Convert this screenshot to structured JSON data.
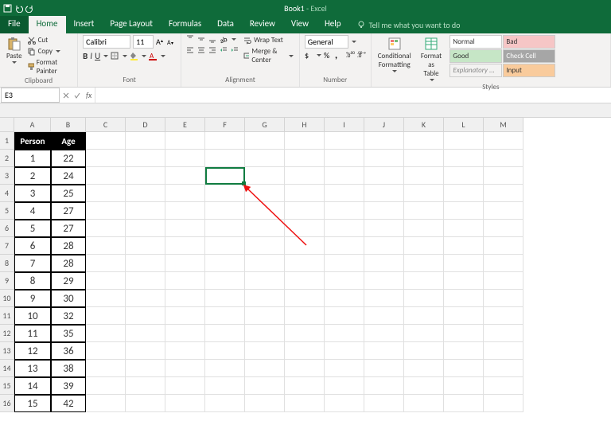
{
  "title": {
    "name": "Book1",
    "app": "Excel"
  },
  "tabs": [
    "File",
    "Home",
    "Insert",
    "Page Layout",
    "Formulas",
    "Data",
    "Review",
    "View",
    "Help"
  ],
  "tell": "Tell me what you want to do",
  "ribbon": {
    "clipboard": {
      "paste": "Paste",
      "cut": "Cut",
      "copy": "Copy",
      "painter": "Format Painter",
      "label": "Clipboard"
    },
    "font": {
      "name": "Calibri",
      "size": "11",
      "label": "Font"
    },
    "alignment": {
      "wrap": "Wrap Text",
      "merge": "Merge & Center",
      "label": "Alignment"
    },
    "number": {
      "format": "General",
      "label": "Number"
    },
    "styles": {
      "cond": "Conditional\nFormatting",
      "fmtas": "Format as\nTable",
      "normal": "Normal",
      "bad": "Bad",
      "good": "Good",
      "check": "Check Cell",
      "expl": "Explanatory ...",
      "input": "Input",
      "label": "Styles"
    }
  },
  "namebox": "E3",
  "cols": [
    "A",
    "B",
    "C",
    "D",
    "E",
    "F",
    "G",
    "H",
    "I",
    "J",
    "K",
    "L",
    "M"
  ],
  "headers": {
    "a": "Person",
    "b": "Age"
  },
  "rows": [
    {
      "n": "1",
      "p": "1",
      "a": "22"
    },
    {
      "n": "2",
      "p": "2",
      "a": "24"
    },
    {
      "n": "3",
      "p": "3",
      "a": "25"
    },
    {
      "n": "4",
      "p": "4",
      "a": "27"
    },
    {
      "n": "5",
      "p": "5",
      "a": "27"
    },
    {
      "n": "6",
      "p": "6",
      "a": "28"
    },
    {
      "n": "7",
      "p": "7",
      "a": "28"
    },
    {
      "n": "8",
      "p": "8",
      "a": "29"
    },
    {
      "n": "9",
      "p": "9",
      "a": "30"
    },
    {
      "n": "10",
      "p": "10",
      "a": "32"
    },
    {
      "n": "11",
      "p": "11",
      "a": "35"
    },
    {
      "n": "12",
      "p": "12",
      "a": "36"
    },
    {
      "n": "13",
      "p": "13",
      "a": "38"
    },
    {
      "n": "14",
      "p": "14",
      "a": "39"
    },
    {
      "n": "15",
      "p": "15",
      "a": "42"
    }
  ]
}
